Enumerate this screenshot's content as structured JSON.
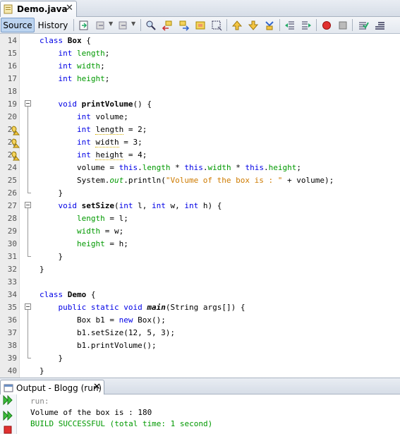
{
  "editor_tab": {
    "filename": "Demo.java",
    "close": "✕"
  },
  "toolbar": {
    "source_label": "Source",
    "history_label": "History"
  },
  "code_lines": [
    {
      "n": "14",
      "html": "<span class=\"kw\">class</span> <span class=\"b\">Box</span> {"
    },
    {
      "n": "15",
      "html": "    <span class=\"kw\">int</span> <span class=\"fld\">length</span>;"
    },
    {
      "n": "16",
      "html": "    <span class=\"kw\">int</span> <span class=\"fld\">width</span>;"
    },
    {
      "n": "17",
      "html": "    <span class=\"kw\">int</span> <span class=\"fld\">height</span>;"
    },
    {
      "n": "18",
      "html": ""
    },
    {
      "n": "19",
      "html": "    <span class=\"kw\">void</span> <span class=\"b\">printVolume</span>() {"
    },
    {
      "n": "20",
      "html": "        <span class=\"kw\">int</span> volume;"
    },
    {
      "n": "21",
      "html": "        <span class=\"kw\">int</span> <span class=\"warn-u\">length</span> = 2;"
    },
    {
      "n": "22",
      "html": "        <span class=\"kw\">int</span> <span class=\"warn-u\">width</span> = 3;"
    },
    {
      "n": "23",
      "html": "        <span class=\"kw\">int</span> <span class=\"warn-u\">height</span> = 4;"
    },
    {
      "n": "24",
      "html": "        volume = <span class=\"kw\">this</span>.<span class=\"fld\">length</span> * <span class=\"kw\">this</span>.<span class=\"fld\">width</span> * <span class=\"kw\">this</span>.<span class=\"fld\">height</span>;"
    },
    {
      "n": "25",
      "html": "        System.<span class=\"stat\">out</span>.println(<span class=\"str\">\"Volume of the box is : \"</span> + volume);"
    },
    {
      "n": "26",
      "html": "    }"
    },
    {
      "n": "27",
      "html": "    <span class=\"kw\">void</span> <span class=\"b\">setSize</span>(<span class=\"kw\">int</span> l, <span class=\"kw\">int</span> w, <span class=\"kw\">int</span> h) {"
    },
    {
      "n": "28",
      "html": "        <span class=\"fld\">length</span> = l;"
    },
    {
      "n": "29",
      "html": "        <span class=\"fld\">width</span> = w;"
    },
    {
      "n": "30",
      "html": "        <span class=\"fld\">height</span> = h;"
    },
    {
      "n": "31",
      "html": "    }"
    },
    {
      "n": "32",
      "html": "}"
    },
    {
      "n": "33",
      "html": ""
    },
    {
      "n": "34",
      "html": "<span class=\"kw\">class</span> <span class=\"b\">Demo</span> {"
    },
    {
      "n": "35",
      "html": "    <span class=\"kw\">public</span> <span class=\"kw\">static</span> <span class=\"kw\">void</span> <span class=\"bi\">main</span>(String args[]) {"
    },
    {
      "n": "36",
      "html": "        Box b1 = <span class=\"kw\">new</span> Box();"
    },
    {
      "n": "37",
      "html": "        b1.setSize(12, 5, 3);"
    },
    {
      "n": "38",
      "html": "        b1.printVolume();"
    },
    {
      "n": "39",
      "html": "    }"
    },
    {
      "n": "40",
      "html": "}"
    }
  ],
  "output": {
    "tab_label": "Output - Blogg (run)",
    "close": "✕",
    "lines": [
      {
        "text": "run:",
        "color": "#888888"
      },
      {
        "text": "Volume of the box is : 180",
        "color": "#000000"
      },
      {
        "text": "BUILD SUCCESSFUL (total time: 1 second)",
        "color": "#009900"
      }
    ]
  },
  "colors": {
    "keyword": "#0000e6",
    "field": "#009900",
    "string": "#ce7b00",
    "success": "#009900"
  }
}
